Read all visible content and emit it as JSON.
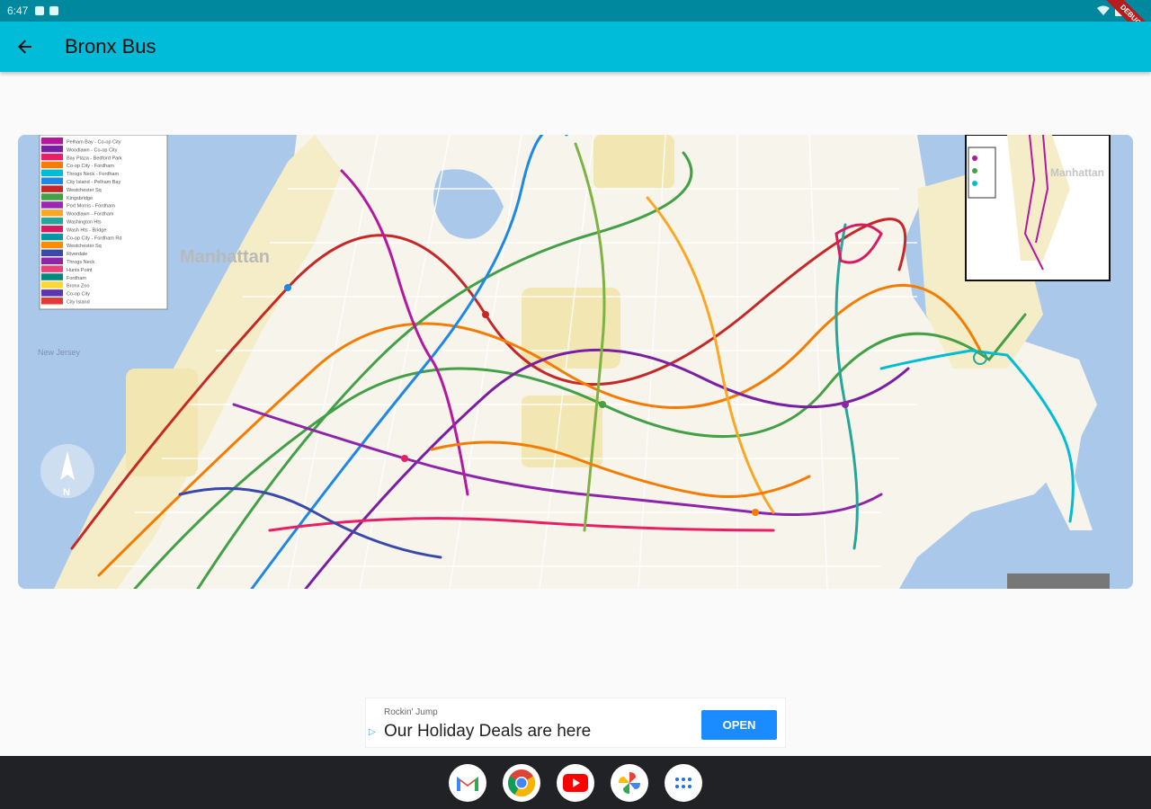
{
  "status_bar": {
    "time": "6:47"
  },
  "app_bar": {
    "title": "Bronx Bus"
  },
  "map": {
    "labels": {
      "manhattan": "Manhattan",
      "manhattan_inset": "Manhattan",
      "new_jersey": "New\nJersey",
      "compass": "N"
    },
    "legend_rows": [
      "Pelham Bay - Co-op City",
      "Woodlawn - Co-op City",
      "Bay Plaza - Bedford Park",
      "Co-op City - Fordham",
      "Throgs Neck - Fordham",
      "City Island - Pelham Bay",
      "Westchester Sq",
      "Kingsbridge",
      "Port Morris - Fordham",
      "Woodlawn - Fordham",
      "Washington Hts",
      "Wash Hts - Bridge",
      "Co-op City - Fordham Rd",
      "Westchester Sq",
      "Riverdale",
      "Throgs Neck",
      "Hunts Point",
      "Fordham",
      "Bronx Zoo",
      "Co-op City",
      "City Island"
    ],
    "legend_colors": [
      "#b5179e",
      "#7b1fa2",
      "#e91e63",
      "#f57c00",
      "#00bcd4",
      "#1e88e5",
      "#c62828",
      "#43a047",
      "#9c27b0",
      "#f9a825",
      "#26a69a",
      "#d81b60",
      "#0097a7",
      "#fb8c00",
      "#3949ab",
      "#8e24aa",
      "#ec407a",
      "#00897b",
      "#fdd835",
      "#5e35b1",
      "#e53935"
    ]
  },
  "ad": {
    "advertiser": "Rockin' Jump",
    "headline": "Our Holiday Deals are here",
    "choice_glyph": "▷",
    "cta": "OPEN"
  },
  "dock": [
    {
      "name": "Gmail",
      "icon": "gmail-icon",
      "color": "#ea4335"
    },
    {
      "name": "Chrome",
      "icon": "chrome-icon",
      "color": "#4285f4"
    },
    {
      "name": "YouTube",
      "icon": "youtube-icon",
      "color": "#ff0000"
    },
    {
      "name": "Photos",
      "icon": "photos-icon",
      "color": "#fbbc04"
    },
    {
      "name": "App Launcher",
      "icon": "apps-grid-icon",
      "color": "#1a73e8"
    }
  ],
  "colors": {
    "status": "#00889e",
    "app_bar": "#00bcd9",
    "water": "#aac8ea",
    "land": "#f7f4ec",
    "park": "#f4edc8"
  }
}
